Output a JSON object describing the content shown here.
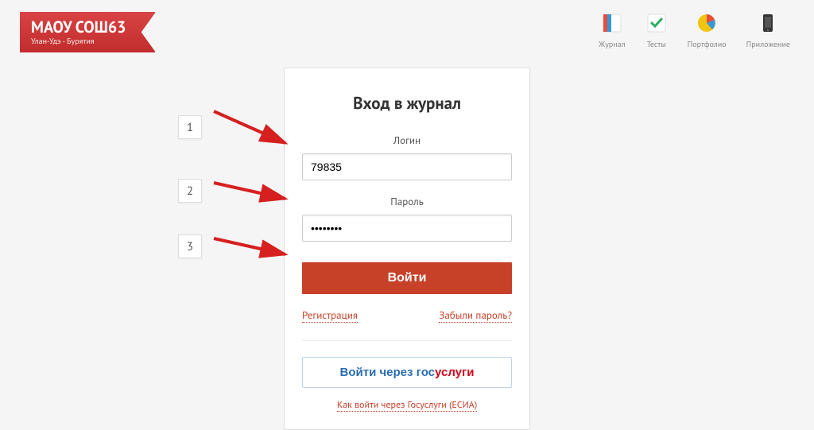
{
  "header": {
    "title": "МАОУ СОШ63",
    "subtitle": "Улан-Удэ - Бурятия"
  },
  "nav": [
    {
      "label": "Журнал"
    },
    {
      "label": "Тесты"
    },
    {
      "label": "Портфолио"
    },
    {
      "label": "Приложение"
    }
  ],
  "login": {
    "title": "Вход в журнал",
    "login_label": "Логин",
    "login_value": "79835",
    "password_label": "Пароль",
    "password_value": "********",
    "submit_label": "Войти",
    "register_link": "Регистрация",
    "forgot_link": "Забыли пароль?",
    "gos_prefix": "Войти через ",
    "gos_blue": "гос",
    "gos_red": "услуги",
    "esia_link": "Как войти через Госуслуги (ЕСИА)"
  },
  "annotations": {
    "n1": "1",
    "n2": "2",
    "n3": "3"
  }
}
